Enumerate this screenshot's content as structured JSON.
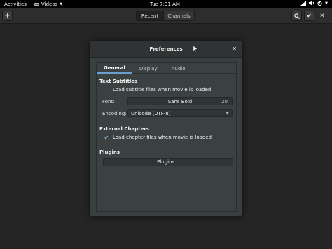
{
  "topbar": {
    "activities": "Activities",
    "app_name": "Videos",
    "clock": "Tue  7:31 AM",
    "status_icons": [
      "network-icon",
      "volume-icon",
      "power-icon"
    ]
  },
  "headerbar": {
    "tabs": [
      "Recent",
      "Channels"
    ],
    "add_icon": "+",
    "search_icon": "🔍",
    "check_icon": "✔",
    "close_icon": "✕"
  },
  "dialog": {
    "title": "Preferences",
    "close_icon": "✕",
    "tabs": [
      "General",
      "Display",
      "Audio"
    ],
    "active_tab": "General",
    "text_subtitles": {
      "heading": "Text Subtitles",
      "load_label": "Load subtitle files when movie is loaded",
      "load_checked": false,
      "font_label": "Font:",
      "font_name": "Sans Bold",
      "font_size": "20",
      "encoding_label": "Encoding:",
      "encoding_value": "Unicode (UTF-8)"
    },
    "external_chapters": {
      "heading": "External Chapters",
      "load_label": "Load chapter files when movie is loaded",
      "load_checked": true
    },
    "plugins": {
      "heading": "Plugins",
      "button_label": "Plugins..."
    }
  },
  "colors": {
    "accent": "#6c9fcf",
    "dialog_bg": "#393f3f",
    "content_bg": "#252525"
  }
}
